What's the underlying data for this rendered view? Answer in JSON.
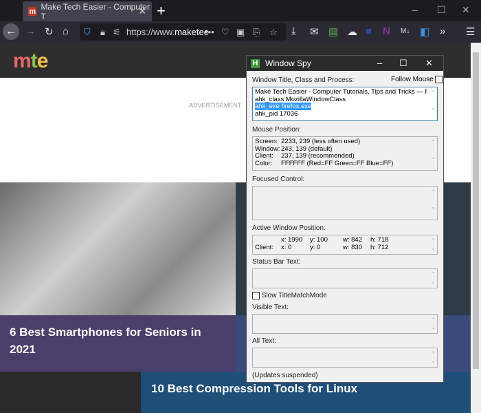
{
  "browser": {
    "tab_title": "Make Tech Easier - Computer T",
    "favicon_letter": "m",
    "url_prefix": "https://www.",
    "url_domain": "maketec",
    "overflow_label": "»"
  },
  "site": {
    "logo": "mte",
    "advertisement": "ADVERTISEMENT",
    "articles": [
      {
        "title": "6 Best Smartphones for Seniors in 2021"
      },
      {
        "title": "10 Best Compression Tools for Linux"
      }
    ]
  },
  "spy": {
    "title": "Window Spy",
    "window_title_label": "Window Title, Class and Process:",
    "follow_mouse_label": "Follow Mouse",
    "follow_mouse_checked": false,
    "window_lines": [
      "Make Tech Easier - Computer Tutorials, Tips and Tricks — Firefox",
      "ahk_class MozillaWindowClass",
      "ahk_exe firefox.exe",
      "ahk_pid 17036"
    ],
    "mouse_label": "Mouse Position:",
    "mouse_rows": [
      {
        "k": "Screen:",
        "v": "2233, 239 (less often used)"
      },
      {
        "k": "Window:",
        "v": "243, 139 (default)"
      },
      {
        "k": "Client:",
        "v": "237, 139 (recommended)"
      },
      {
        "k": "Color:",
        "v": "FFFFFF (Red=FF Green=FF Blue=FF)"
      }
    ],
    "focused_label": "Focused Control:",
    "active_label": "Active Window Position:",
    "active_rows": [
      {
        "k": "",
        "x": "x: 1990",
        "y": "y: 100",
        "w": "w: 842",
        "h": "h: 718"
      },
      {
        "k": "Client:",
        "x": "x: 0",
        "y": "y: 0",
        "w": "w: 830",
        "h": "h: 712"
      }
    ],
    "status_label": "Status Bar Text:",
    "slow_label": "Slow TitleMatchMode",
    "slow_checked": false,
    "visible_label": "Visible Text:",
    "all_label": "All Text:",
    "footer": "(Updates suspended)"
  }
}
